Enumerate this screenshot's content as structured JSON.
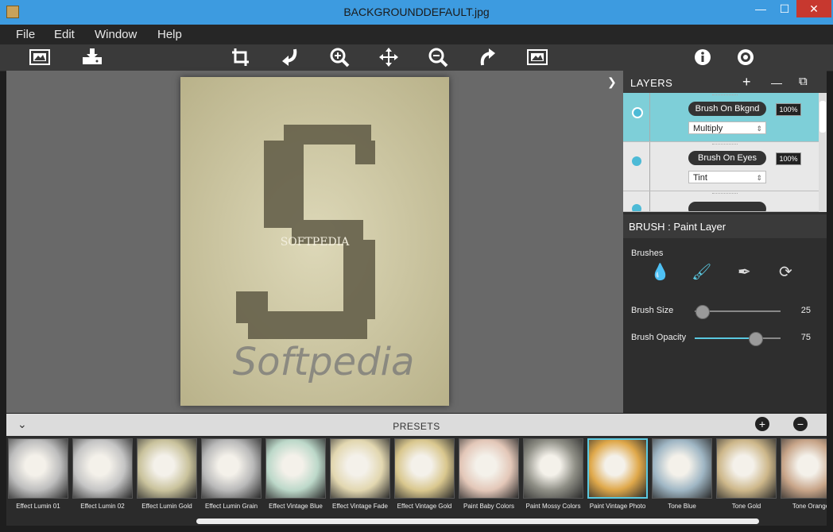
{
  "window": {
    "title": "BACKGROUNDDEFAULT.jpg",
    "minimize": "—",
    "maximize": "☐",
    "close": "✕"
  },
  "menu": [
    "File",
    "Edit",
    "Window",
    "Help"
  ],
  "toolbar": {
    "icons": [
      "open-image-icon",
      "save-icon",
      "crop-icon",
      "undo-icon",
      "zoom-in-icon",
      "move-icon",
      "zoom-out-icon",
      "redo-icon",
      "compare-image-icon",
      "info-icon",
      "settings-icon"
    ]
  },
  "canvas": {
    "watermark": "SOFTPEDIA",
    "signature": "Softpedia"
  },
  "layers": {
    "title": "LAYERS",
    "add": "+",
    "remove": "—",
    "duplicate": "⧉",
    "items": [
      {
        "name": "Brush On Bkgnd",
        "opacity": "100%",
        "blend": "Multiply",
        "selected": true
      },
      {
        "name": "Brush On Eyes",
        "opacity": "100%",
        "blend": "Tint",
        "selected": false
      }
    ]
  },
  "brush": {
    "title": "BRUSH : Paint Layer",
    "brushes_label": "Brushes",
    "size_label": "Brush Size",
    "size_value": "25",
    "size_fraction": 0.08,
    "opacity_label": "Brush Opacity",
    "opacity_value": "75",
    "opacity_fraction": 0.7,
    "accent": "#5ac8e0"
  },
  "presets": {
    "title": "PRESETS",
    "items": [
      {
        "label": "Effect Lumin 01",
        "tint": "#bdbdbd"
      },
      {
        "label": "Effect Lumin 02",
        "tint": "#c4c4c4"
      },
      {
        "label": "Effect Lumin Gold",
        "tint": "#c9c29c"
      },
      {
        "label": "Effect Lumin Grain",
        "tint": "#b9b9b9"
      },
      {
        "label": "Effect Vintage Blue",
        "tint": "#bcd8c9"
      },
      {
        "label": "Effect Vintage Fade",
        "tint": "#e2d7b0"
      },
      {
        "label": "Effect Vintage Gold",
        "tint": "#d9c78e"
      },
      {
        "label": "Paint Baby Colors",
        "tint": "#e3c7b8"
      },
      {
        "label": "Paint Mossy Colors",
        "tint": "#8f8f86"
      },
      {
        "label": "Paint Vintage Photo",
        "tint": "#dfa84a",
        "selected": true
      },
      {
        "label": "Tone Blue",
        "tint": "#9fb6c4"
      },
      {
        "label": "Tone Gold",
        "tint": "#cdb78a"
      },
      {
        "label": "Tone Orange",
        "tint": "#c7a488"
      }
    ]
  }
}
